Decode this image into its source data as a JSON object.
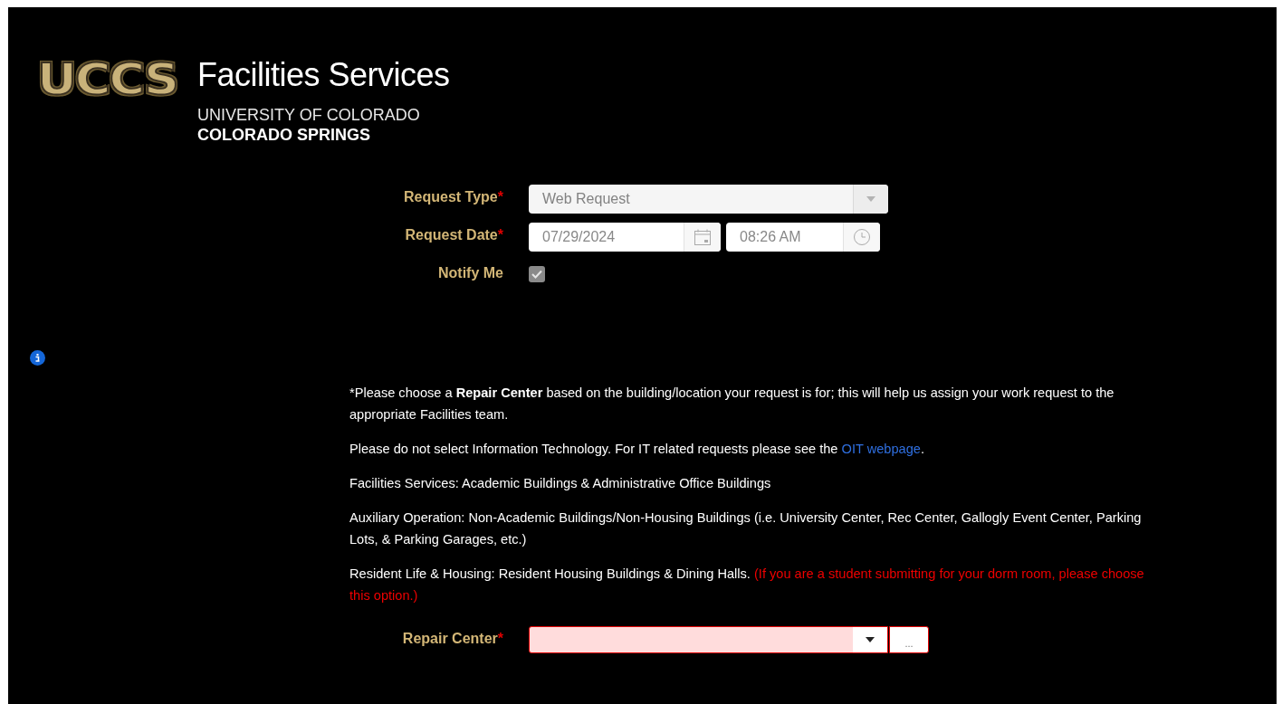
{
  "header": {
    "logo": "UCCS",
    "title": "Facilities Services",
    "subtitle_1": "UNIVERSITY OF COLORADO",
    "subtitle_2": "COLORADO SPRINGS"
  },
  "form": {
    "fields": [
      {
        "kind": "select",
        "label": "Request Type",
        "required_mark": "*",
        "value": "Web Request",
        "disabled": true
      },
      {
        "kind": "datetime",
        "label": "Request Date",
        "required_mark": "*",
        "date": "07/29/2024",
        "time": "08:26 AM"
      },
      {
        "kind": "checkbox",
        "label": "Notify Me",
        "checked": true,
        "disabled": true
      }
    ]
  },
  "instructions": [
    {
      "text": "*Please choose a **Repair Center** based on the building/location your request is for; this will help us assign your work request to the appropriate Facilities team."
    },
    {
      "text": "Please do not select Information Technology. For IT related requests please see the ",
      "link": "OIT webpage",
      "after": "."
    },
    {
      "text": "Facilities Services: Academic Buildings & Administrative Office Buildings"
    },
    {
      "text": "Auxiliary Operation: Non-Academic Buildings/Non-Housing Buildings (i.e. University Center, Rec Center, Gallogly Event Center, Parking Lots, & Parking Garages, etc.)"
    },
    {
      "text": "Resident Life & Housing: Resident Housing Buildings & Dining Halls. ",
      "warning": "(If you are a student submitting for your dorm room, please choose this option.)"
    }
  ],
  "repair_center": {
    "label": "Repair Center",
    "required_mark": "*",
    "invalid": true,
    "more_button": "..."
  }
}
